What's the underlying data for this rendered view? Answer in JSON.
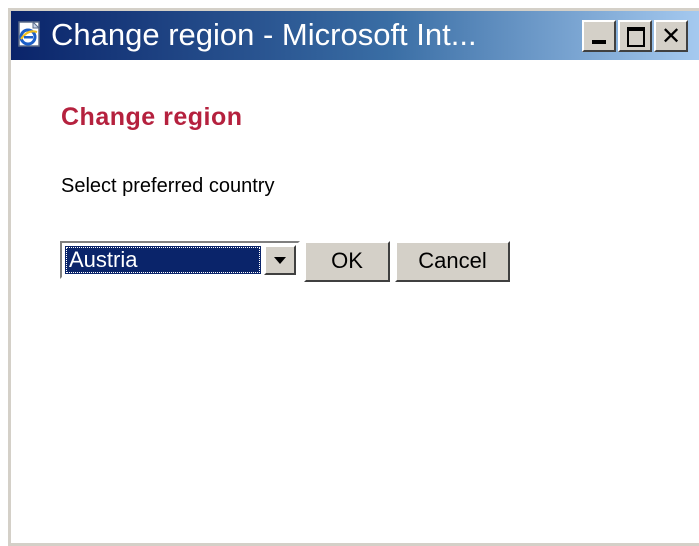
{
  "window": {
    "title": "Change region - Microsoft Int...",
    "icon": "ie-page-icon"
  },
  "dialog": {
    "heading": "Change region",
    "label": "Select preferred country",
    "country_select": {
      "selected": "Austria"
    },
    "ok_label": "OK",
    "cancel_label": "Cancel"
  },
  "colors": {
    "heading": "#b5213e",
    "titlebar_start": "#0a246a",
    "titlebar_end": "#a6caf0",
    "selection": "#0a246a",
    "button_face": "#d4d0c8"
  }
}
